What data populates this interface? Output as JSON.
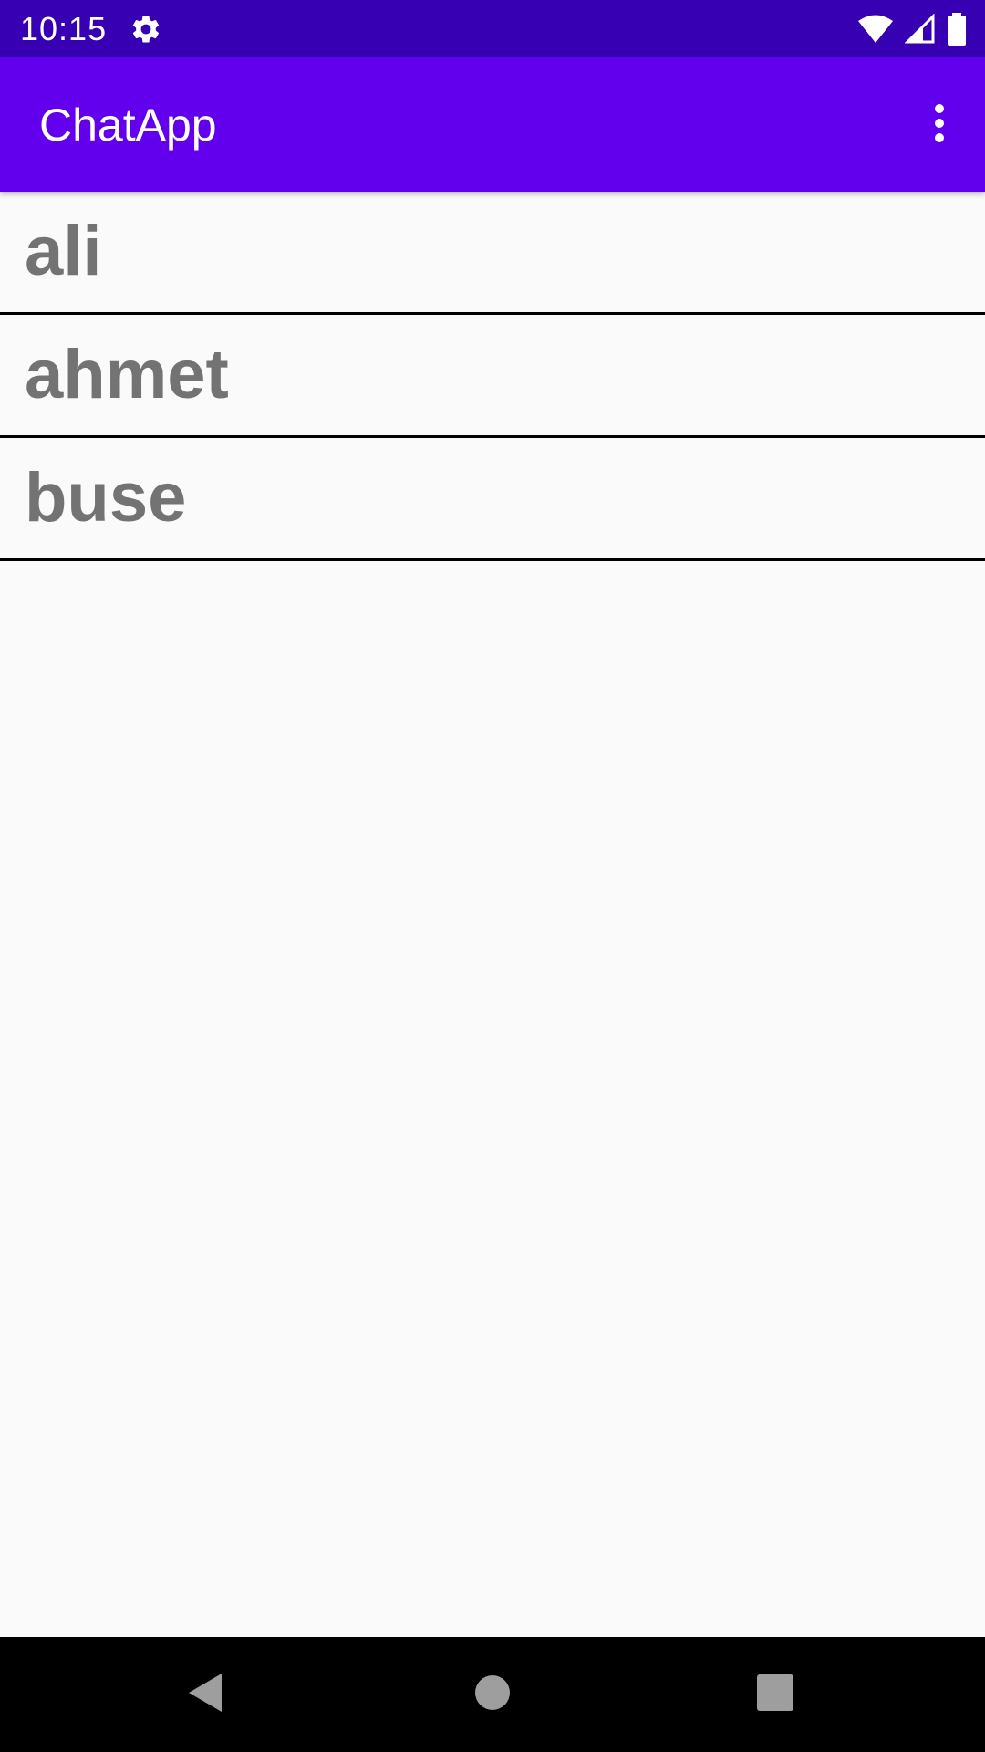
{
  "status_bar": {
    "time": "10:15",
    "icons": [
      "settings-icon",
      "wifi-icon",
      "cell-signal-icon",
      "battery-icon"
    ]
  },
  "app_bar": {
    "title": "ChatApp",
    "menu_icon": "more-vertical-icon"
  },
  "users": [
    {
      "name": "ali"
    },
    {
      "name": "ahmet"
    },
    {
      "name": "buse"
    }
  ],
  "nav_bar": {
    "icons": [
      "back-icon",
      "home-icon",
      "recents-icon"
    ]
  },
  "colors": {
    "status_bar": "#3700b3",
    "app_bar": "#6200ee",
    "background": "#fafafa",
    "list_text": "#737373",
    "divider": "#000000"
  }
}
